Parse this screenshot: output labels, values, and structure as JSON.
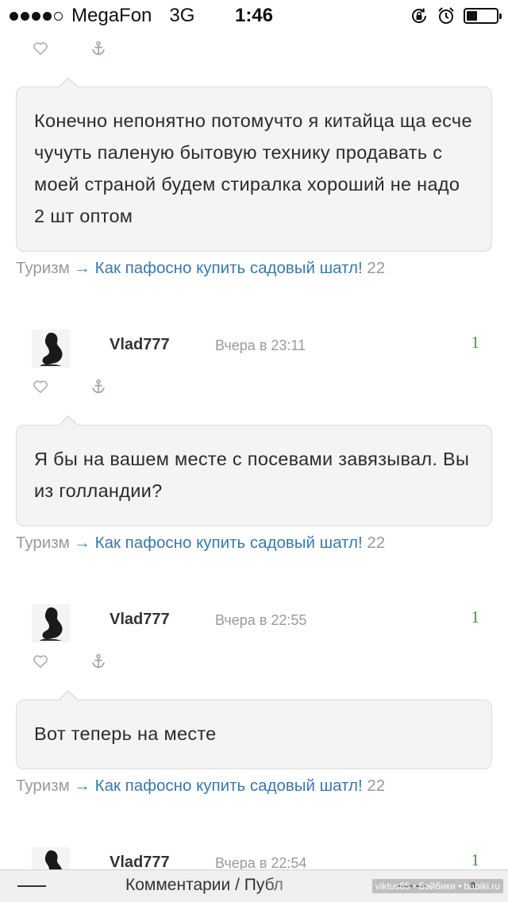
{
  "status_bar": {
    "carrier": "MegaFon",
    "network": "3G",
    "time": "1:46",
    "signal_dots_filled": 4,
    "signal_dots_total": 5,
    "battery_level": 0.35
  },
  "icons": {
    "like": "heart-outline-icon",
    "link": "anchor-icon"
  },
  "comments": [
    {
      "text": "Конечно непонятно потомучто я китайца ща есче чучуть паленую бытовую технику продавать с моей страной будем стиралка хороший не надо 2 шт оптом",
      "post": {
        "category": "Туризм",
        "arrow": "→",
        "title": "Как пафосно купить садовый шатл!",
        "count": "22"
      }
    },
    {
      "author": "Vlad777",
      "date": "Вчера в 23:11",
      "rating": "1",
      "text": "Я бы на вашем месте с посевами завязывал. Вы из голландии?",
      "post": {
        "category": "Туризм",
        "arrow": "→",
        "title": "Как пафосно купить садовый шатл!",
        "count": "22"
      }
    },
    {
      "author": "Vlad777",
      "date": "Вчера в 22:55",
      "rating": "1",
      "text": "Вот теперь на месте",
      "post": {
        "category": "Туризм",
        "arrow": "→",
        "title": "Как пафосно купить садовый шатл!",
        "count": "22"
      }
    },
    {
      "author": "Vlad777",
      "date": "Вчера в 22:54",
      "rating": "1"
    }
  ],
  "bottom_bar": {
    "title": "Комментарии / Публ",
    "watermark": "viktus85 • Бэйбики • babiki.ru"
  },
  "colors": {
    "link": "#3a78ad",
    "muted": "#999999",
    "rating": "#3f9a3f",
    "bubble_bg": "#f4f4f4",
    "bubble_border": "#dcdcdc"
  }
}
